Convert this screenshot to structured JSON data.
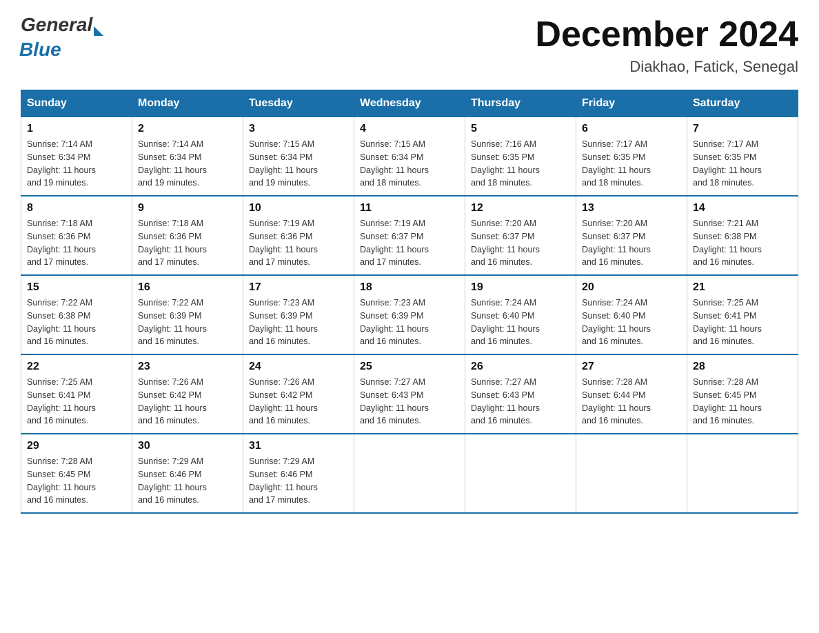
{
  "header": {
    "logo_general": "General",
    "logo_blue": "Blue",
    "month_title": "December 2024",
    "location": "Diakhao, Fatick, Senegal"
  },
  "days_of_week": [
    "Sunday",
    "Monday",
    "Tuesday",
    "Wednesday",
    "Thursday",
    "Friday",
    "Saturday"
  ],
  "weeks": [
    [
      {
        "day": "1",
        "sunrise": "7:14 AM",
        "sunset": "6:34 PM",
        "daylight": "11 hours and 19 minutes."
      },
      {
        "day": "2",
        "sunrise": "7:14 AM",
        "sunset": "6:34 PM",
        "daylight": "11 hours and 19 minutes."
      },
      {
        "day": "3",
        "sunrise": "7:15 AM",
        "sunset": "6:34 PM",
        "daylight": "11 hours and 19 minutes."
      },
      {
        "day": "4",
        "sunrise": "7:15 AM",
        "sunset": "6:34 PM",
        "daylight": "11 hours and 18 minutes."
      },
      {
        "day": "5",
        "sunrise": "7:16 AM",
        "sunset": "6:35 PM",
        "daylight": "11 hours and 18 minutes."
      },
      {
        "day": "6",
        "sunrise": "7:17 AM",
        "sunset": "6:35 PM",
        "daylight": "11 hours and 18 minutes."
      },
      {
        "day": "7",
        "sunrise": "7:17 AM",
        "sunset": "6:35 PM",
        "daylight": "11 hours and 18 minutes."
      }
    ],
    [
      {
        "day": "8",
        "sunrise": "7:18 AM",
        "sunset": "6:36 PM",
        "daylight": "11 hours and 17 minutes."
      },
      {
        "day": "9",
        "sunrise": "7:18 AM",
        "sunset": "6:36 PM",
        "daylight": "11 hours and 17 minutes."
      },
      {
        "day": "10",
        "sunrise": "7:19 AM",
        "sunset": "6:36 PM",
        "daylight": "11 hours and 17 minutes."
      },
      {
        "day": "11",
        "sunrise": "7:19 AM",
        "sunset": "6:37 PM",
        "daylight": "11 hours and 17 minutes."
      },
      {
        "day": "12",
        "sunrise": "7:20 AM",
        "sunset": "6:37 PM",
        "daylight": "11 hours and 16 minutes."
      },
      {
        "day": "13",
        "sunrise": "7:20 AM",
        "sunset": "6:37 PM",
        "daylight": "11 hours and 16 minutes."
      },
      {
        "day": "14",
        "sunrise": "7:21 AM",
        "sunset": "6:38 PM",
        "daylight": "11 hours and 16 minutes."
      }
    ],
    [
      {
        "day": "15",
        "sunrise": "7:22 AM",
        "sunset": "6:38 PM",
        "daylight": "11 hours and 16 minutes."
      },
      {
        "day": "16",
        "sunrise": "7:22 AM",
        "sunset": "6:39 PM",
        "daylight": "11 hours and 16 minutes."
      },
      {
        "day": "17",
        "sunrise": "7:23 AM",
        "sunset": "6:39 PM",
        "daylight": "11 hours and 16 minutes."
      },
      {
        "day": "18",
        "sunrise": "7:23 AM",
        "sunset": "6:39 PM",
        "daylight": "11 hours and 16 minutes."
      },
      {
        "day": "19",
        "sunrise": "7:24 AM",
        "sunset": "6:40 PM",
        "daylight": "11 hours and 16 minutes."
      },
      {
        "day": "20",
        "sunrise": "7:24 AM",
        "sunset": "6:40 PM",
        "daylight": "11 hours and 16 minutes."
      },
      {
        "day": "21",
        "sunrise": "7:25 AM",
        "sunset": "6:41 PM",
        "daylight": "11 hours and 16 minutes."
      }
    ],
    [
      {
        "day": "22",
        "sunrise": "7:25 AM",
        "sunset": "6:41 PM",
        "daylight": "11 hours and 16 minutes."
      },
      {
        "day": "23",
        "sunrise": "7:26 AM",
        "sunset": "6:42 PM",
        "daylight": "11 hours and 16 minutes."
      },
      {
        "day": "24",
        "sunrise": "7:26 AM",
        "sunset": "6:42 PM",
        "daylight": "11 hours and 16 minutes."
      },
      {
        "day": "25",
        "sunrise": "7:27 AM",
        "sunset": "6:43 PM",
        "daylight": "11 hours and 16 minutes."
      },
      {
        "day": "26",
        "sunrise": "7:27 AM",
        "sunset": "6:43 PM",
        "daylight": "11 hours and 16 minutes."
      },
      {
        "day": "27",
        "sunrise": "7:28 AM",
        "sunset": "6:44 PM",
        "daylight": "11 hours and 16 minutes."
      },
      {
        "day": "28",
        "sunrise": "7:28 AM",
        "sunset": "6:45 PM",
        "daylight": "11 hours and 16 minutes."
      }
    ],
    [
      {
        "day": "29",
        "sunrise": "7:28 AM",
        "sunset": "6:45 PM",
        "daylight": "11 hours and 16 minutes."
      },
      {
        "day": "30",
        "sunrise": "7:29 AM",
        "sunset": "6:46 PM",
        "daylight": "11 hours and 16 minutes."
      },
      {
        "day": "31",
        "sunrise": "7:29 AM",
        "sunset": "6:46 PM",
        "daylight": "11 hours and 17 minutes."
      },
      null,
      null,
      null,
      null
    ]
  ],
  "labels": {
    "sunrise": "Sunrise:",
    "sunset": "Sunset:",
    "daylight": "Daylight:"
  }
}
